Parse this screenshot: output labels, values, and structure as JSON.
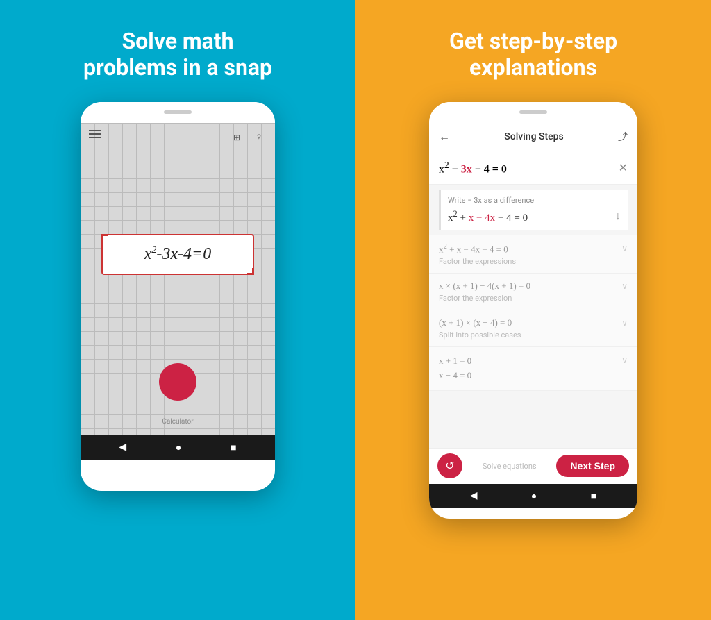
{
  "left": {
    "bg_color": "#1AABCE",
    "title": "Solve math\nproblems in a snap",
    "equation": "x²-3x-4=0",
    "calc_label": "Calculator"
  },
  "right": {
    "bg_color": "#F5A623",
    "title": "Get step-by-step\nexplanations",
    "phone": {
      "header": {
        "back": "←",
        "title": "Solving Steps",
        "share": "⤴"
      },
      "main_equation": "x² - 3x - 4 = 0",
      "step1": {
        "desc": "Write − 3x as a difference",
        "equation": "x² + x − 4x − 4 = 0"
      },
      "collapsed_steps": [
        {
          "eq": "x² + x − 4x − 4 = 0",
          "label": "Factor the expressions"
        },
        {
          "eq": "x × (x + 1) − 4(x + 1) = 0",
          "label": "Factor the expression"
        },
        {
          "eq": "(x + 1) × (x − 4) = 0",
          "label": "Split into possible cases"
        }
      ],
      "last_step": {
        "eqs": "x + 1 = 0\nx − 4 = 0",
        "label": "Solve equations"
      },
      "next_step_label": "Next Step",
      "replay_label": "↺"
    }
  }
}
